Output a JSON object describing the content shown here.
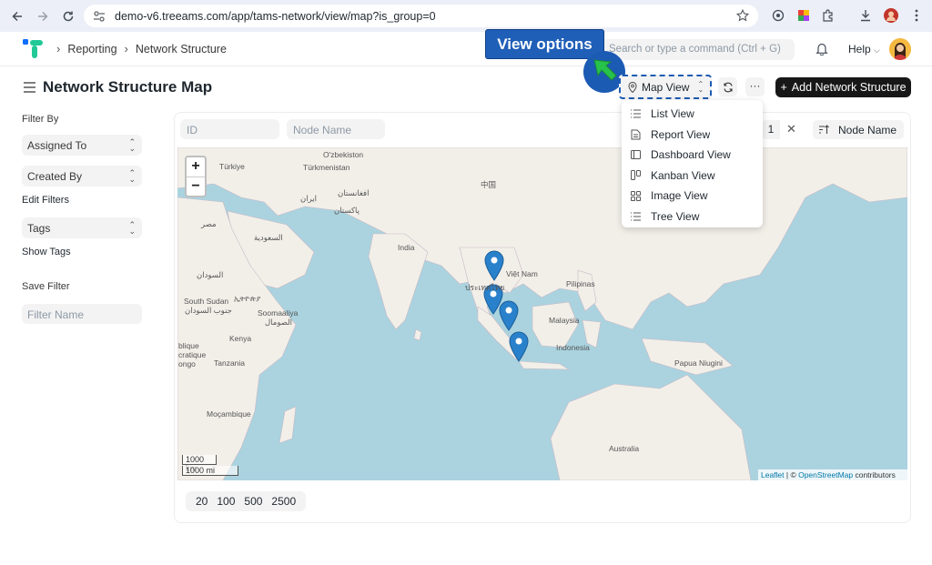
{
  "browser": {
    "url": "demo-v6.treeams.com/app/tams-network/view/map?is_group=0"
  },
  "header": {
    "breadcrumbs": [
      "Reporting",
      "Network Structure"
    ],
    "search_placeholder": "Search or type a command (Ctrl + G)",
    "help_label": "Help"
  },
  "page": {
    "title": "Network Structure Map",
    "callout": "View options",
    "view_button_label": "Map View",
    "more_label": "···",
    "add_button_label": "Add Network Structure"
  },
  "sidebar": {
    "filter_by_label": "Filter By",
    "assigned_to": "Assigned To",
    "created_by": "Created By",
    "edit_filters": "Edit Filters",
    "tags": "Tags",
    "show_tags": "Show Tags",
    "save_filter_label": "Save Filter",
    "filter_name_placeholder": "Filter Name"
  },
  "filters": {
    "id_placeholder": "ID",
    "node_name_placeholder": "Node Name",
    "filter_count": "1",
    "sort_label": "Node Name"
  },
  "view_menu": [
    {
      "label": "List View",
      "icon": "list-icon"
    },
    {
      "label": "Report View",
      "icon": "report-icon"
    },
    {
      "label": "Dashboard View",
      "icon": "dashboard-icon"
    },
    {
      "label": "Kanban View",
      "icon": "kanban-icon"
    },
    {
      "label": "Image View",
      "icon": "image-grid-icon"
    },
    {
      "label": "Tree View",
      "icon": "tree-icon"
    }
  ],
  "map": {
    "zoom_in": "+",
    "zoom_out": "−",
    "scale_km": "1000 km",
    "scale_mi": "1000 mi",
    "attribution_leaflet": "Leaflet",
    "attribution_sep": " | © ",
    "attribution_osm": "OpenStreetMap",
    "attribution_tail": " contributors",
    "labels": {
      "turkiye": "Türkiye",
      "uzbekistan": "O'zbekiston",
      "turkmenistan": "Türkmenistan",
      "iran": "ایران",
      "afghanistan": "افغانستان",
      "pakistan": "پاکستان",
      "china": "中国",
      "egypt": "مصر",
      "saudi": "السعودية",
      "india": "India",
      "sudan": "السودان",
      "vietnam": "Việt Nam",
      "thailand": "ประเทศไทย",
      "philippines": "Pilipinas",
      "south_sudan": "South Sudan",
      "ethiopia": "ኢትዮጵያ",
      "south_sudan_ar": "جنوب السودان",
      "somalia": "Soomaaliya",
      "somalia_ar": "الصومال",
      "malaysia": "Malaysia",
      "kenya": "Kenya",
      "congo1": "blique",
      "congo2": "cratique",
      "congo3": "ongo",
      "tanzania": "Tanzania",
      "indonesia": "Indonesia",
      "png": "Papua Niugini",
      "mozambique": "Moçambique",
      "australia": "Australia"
    }
  },
  "pager": [
    "20",
    "100",
    "500",
    "2500"
  ],
  "colors": {
    "accent": "#1c5bb3",
    "water": "#aad3df",
    "land": "#f2efe9",
    "marker": "#2a81cb"
  }
}
